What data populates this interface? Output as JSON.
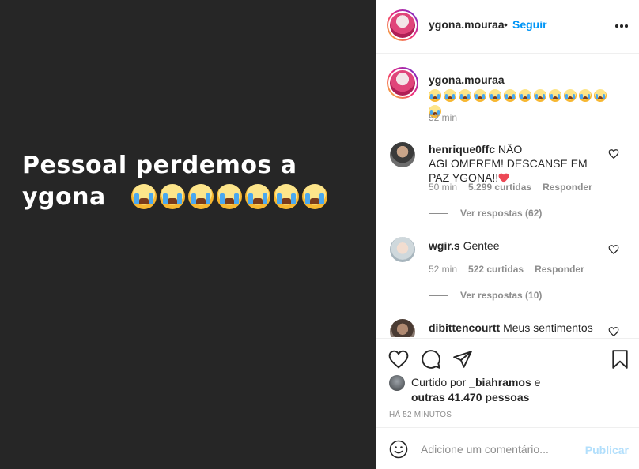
{
  "post": {
    "story_line1": "Pessoal perdemos a",
    "story_line2": "ygona"
  },
  "header": {
    "username": "ygona.mouraa",
    "separator": "•",
    "follow_label": "Seguir",
    "more_icon": "more-options-icon"
  },
  "caption": {
    "username": "ygona.mouraa",
    "emoji": "loudly-crying-face",
    "time": "52 min"
  },
  "comments": [
    {
      "username": "henrique0ffc",
      "text": "NÃO AGLOMEREM! DESCANSE EM PAZ YGONA!!",
      "time": "50 min",
      "likes": "5.299 curtidas",
      "reply_label": "Responder",
      "replies": "Ver respostas (62)"
    },
    {
      "username": "wgir.s",
      "text": "Gentee",
      "time": "52 min",
      "likes": "522 curtidas",
      "reply_label": "Responder",
      "replies": "Ver respostas (10)"
    },
    {
      "username": "dibittencourtt",
      "text": "Meus sentimentos"
    }
  ],
  "likes": {
    "prefix": "Curtido por",
    "user": "_biahramos",
    "connector": "e",
    "others": "outras 41.470 pessoas"
  },
  "timestamp": "HÁ 52 MINUTOS",
  "comment_box": {
    "placeholder": "Adicione um comentário...",
    "publish_label": "Publicar"
  },
  "colors": {
    "accent": "#0095f6",
    "publish_disabled": "#b2dffc",
    "heart_red": "#ed4956"
  }
}
